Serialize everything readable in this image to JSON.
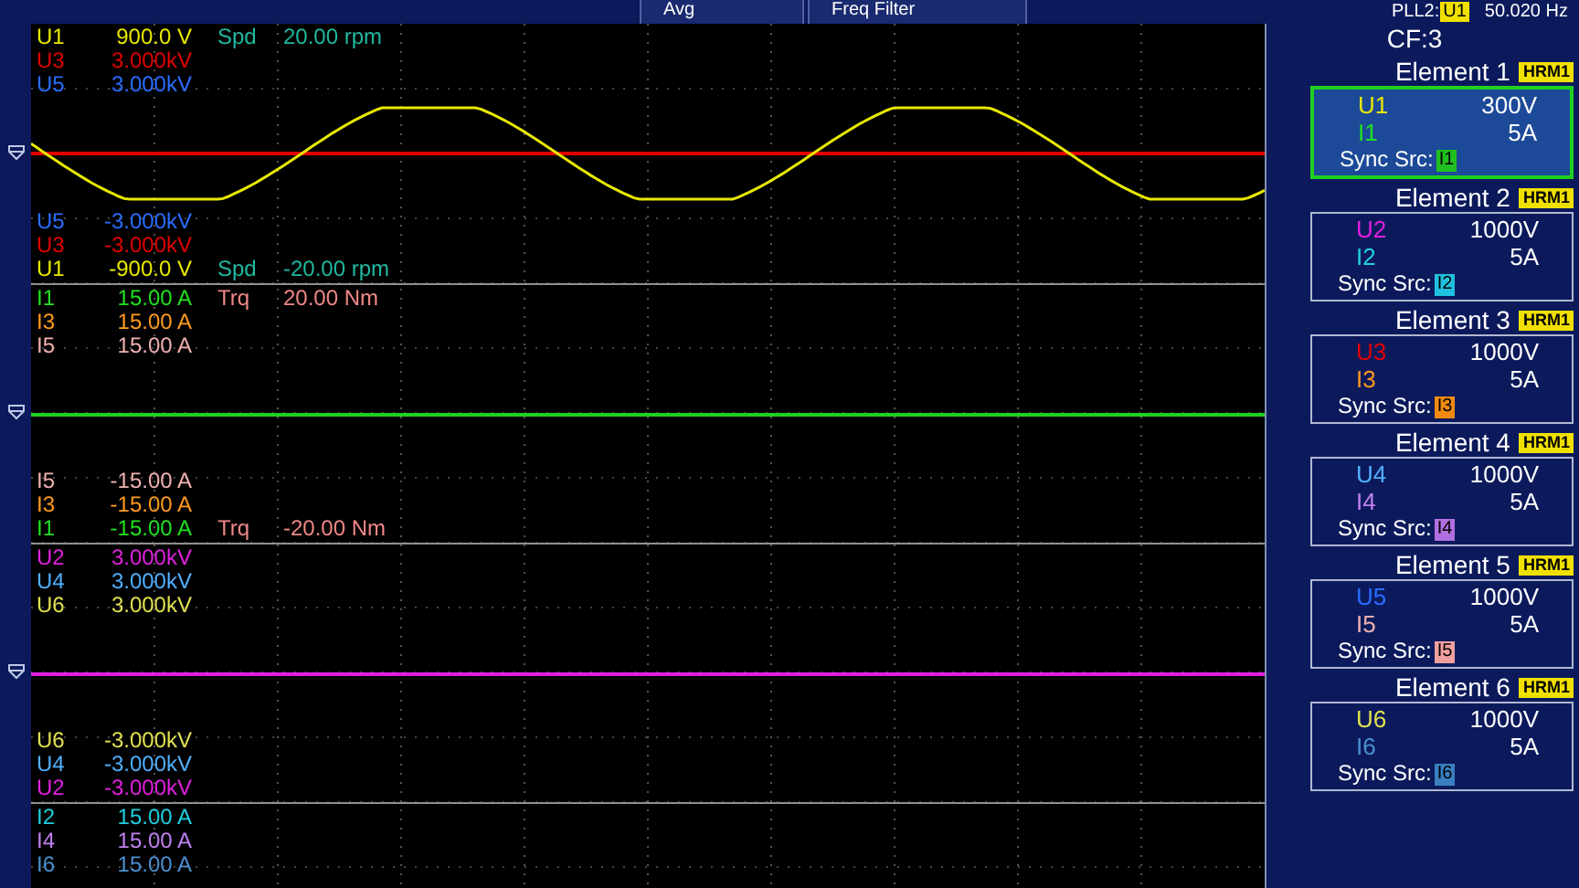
{
  "top_bar": {
    "tabs": [
      {
        "label": "Avg"
      },
      {
        "label": "Freq Filter"
      }
    ],
    "pll": {
      "label": "PLL2:",
      "source": "U1",
      "frequency": "50.020 Hz"
    }
  },
  "groups": [
    {
      "color": "#e00000",
      "trace": {
        "color": "#e8e800"
      },
      "top_rows": [
        {
          "channel": "U1",
          "value": "900.0 V",
          "color": "#e8e800",
          "aux": {
            "label": "Spd",
            "value": "20.00 rpm",
            "color": "#20b8a0"
          }
        },
        {
          "channel": "U3",
          "value": "3.000kV",
          "color": "#e00000"
        },
        {
          "channel": "U5",
          "value": "3.000kV",
          "color": "#2a6cff"
        }
      ],
      "bottom_rows": [
        {
          "channel": "U5",
          "value": "-3.000kV",
          "color": "#2a6cff"
        },
        {
          "channel": "U3",
          "value": "-3.000kV",
          "color": "#e00000"
        },
        {
          "channel": "U1",
          "value": "-900.0 V",
          "color": "#e8e800",
          "aux": {
            "label": "Spd",
            "value": "-20.00 rpm",
            "color": "#20b8a0"
          }
        }
      ]
    },
    {
      "color": "#20d020",
      "top_rows": [
        {
          "channel": "I1",
          "value": "15.00 A",
          "color": "#20e020",
          "aux": {
            "label": "Trq",
            "value": "20.00 Nm",
            "color": "#f08888"
          }
        },
        {
          "channel": "I3",
          "value": "15.00 A",
          "color": "#ff9a20"
        },
        {
          "channel": "I5",
          "value": "15.00 A",
          "color": "#f0b0b0"
        }
      ],
      "bottom_rows": [
        {
          "channel": "I5",
          "value": "-15.00 A",
          "color": "#f0b0b0"
        },
        {
          "channel": "I3",
          "value": "-15.00 A",
          "color": "#ff9a20"
        },
        {
          "channel": "I1",
          "value": "-15.00 A",
          "color": "#20e020",
          "aux": {
            "label": "Trq",
            "value": "-20.00 Nm",
            "color": "#f08888"
          }
        }
      ]
    },
    {
      "color": "#e020e0",
      "top_rows": [
        {
          "channel": "U2",
          "value": "3.000kV",
          "color": "#e020e0"
        },
        {
          "channel": "U4",
          "value": "3.000kV",
          "color": "#50b0ff"
        },
        {
          "channel": "U6",
          "value": "3.000kV",
          "color": "#e0e050"
        }
      ],
      "bottom_rows": [
        {
          "channel": "U6",
          "value": "-3.000kV",
          "color": "#e0e050"
        },
        {
          "channel": "U4",
          "value": "-3.000kV",
          "color": "#50b0ff"
        },
        {
          "channel": "U2",
          "value": "-3.000kV",
          "color": "#e020e0"
        }
      ]
    },
    {
      "top_rows": [
        {
          "channel": "I2",
          "value": "15.00 A",
          "color": "#20d0e0"
        },
        {
          "channel": "I4",
          "value": "15.00 A",
          "color": "#c080f0"
        },
        {
          "channel": "I6",
          "value": "15.00 A",
          "color": "#4a90d0"
        }
      ]
    }
  ],
  "panel": {
    "crest_factor": "CF:3",
    "elements": [
      {
        "title": "Element 1",
        "badge": "HRM1",
        "selected": true,
        "voltage": {
          "channel": "U1",
          "range": "300V",
          "color": "#e8e800"
        },
        "current": {
          "channel": "I1",
          "range": "5A",
          "color": "#20e020"
        },
        "sync_label": "Sync Src:",
        "sync_source": {
          "channel": "I1",
          "color": "#20c020"
        }
      },
      {
        "title": "Element 2",
        "badge": "HRM1",
        "selected": false,
        "voltage": {
          "channel": "U2",
          "range": "1000V",
          "color": "#e020e0"
        },
        "current": {
          "channel": "I2",
          "range": "5A",
          "color": "#20d0e0"
        },
        "sync_label": "Sync Src:",
        "sync_source": {
          "channel": "I2",
          "color": "#20c0e0"
        }
      },
      {
        "title": "Element 3",
        "badge": "HRM1",
        "selected": false,
        "voltage": {
          "channel": "U3",
          "range": "1000V",
          "color": "#e00000"
        },
        "current": {
          "channel": "I3",
          "range": "5A",
          "color": "#ff9a20"
        },
        "sync_label": "Sync Src:",
        "sync_source": {
          "channel": "I3",
          "color": "#f08a10"
        }
      },
      {
        "title": "Element 4",
        "badge": "HRM1",
        "selected": false,
        "voltage": {
          "channel": "U4",
          "range": "1000V",
          "color": "#50b0ff"
        },
        "current": {
          "channel": "I4",
          "range": "5A",
          "color": "#c080f0"
        },
        "sync_label": "Sync Src:",
        "sync_source": {
          "channel": "I4",
          "color": "#b070e0"
        }
      },
      {
        "title": "Element 5",
        "badge": "HRM1",
        "selected": false,
        "voltage": {
          "channel": "U5",
          "range": "1000V",
          "color": "#2a6cff"
        },
        "current": {
          "channel": "I5",
          "range": "5A",
          "color": "#f0b0b0"
        },
        "sync_label": "Sync Src:",
        "sync_source": {
          "channel": "I5",
          "color": "#f0a0a0"
        }
      },
      {
        "title": "Element 6",
        "badge": "HRM1",
        "selected": false,
        "voltage": {
          "channel": "U6",
          "range": "1000V",
          "color": "#e0e050"
        },
        "current": {
          "channel": "I6",
          "range": "5A",
          "color": "#4a90d0"
        },
        "sync_label": "Sync Src:",
        "sync_source": {
          "channel": "I6",
          "color": "#3a80c0"
        }
      }
    ]
  }
}
